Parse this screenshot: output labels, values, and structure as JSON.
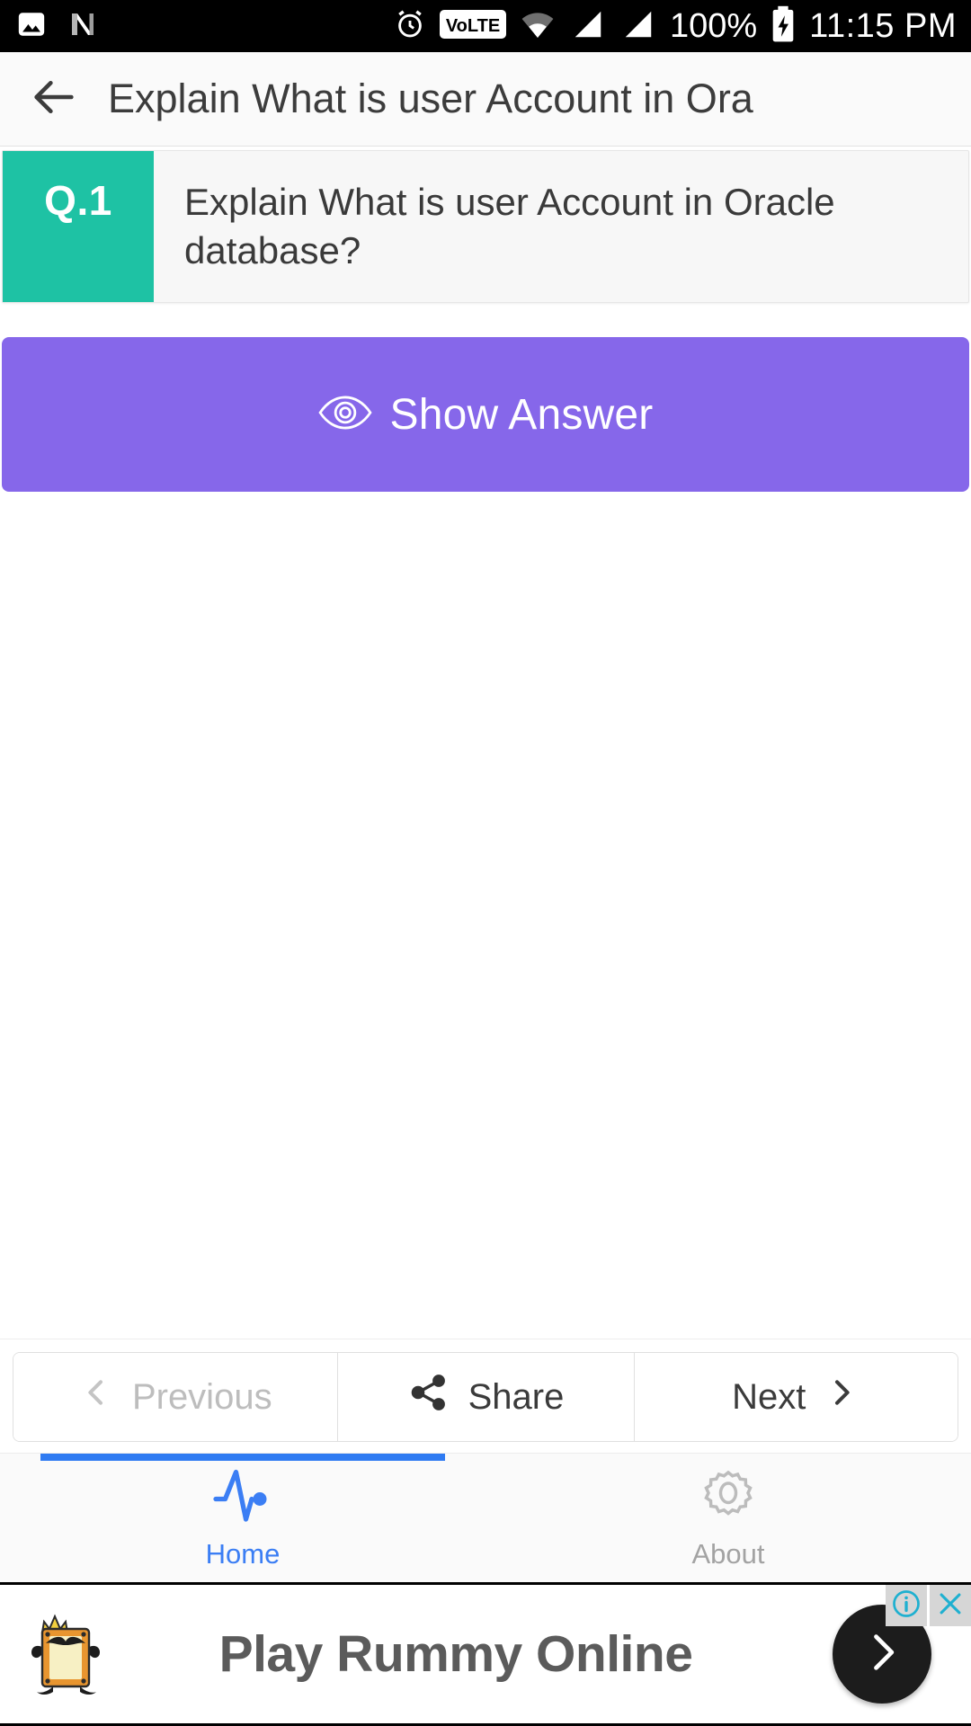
{
  "statusbar": {
    "icons_left": [
      "photo-icon",
      "android-nougat-icon"
    ],
    "icons_right": [
      "alarm-icon",
      "volte-icon",
      "wifi-icon",
      "signal-1-icon",
      "signal-2-icon",
      "battery-charging-icon"
    ],
    "volte_label": "VoLTE",
    "battery_percent": "100%",
    "time": "11:15 PM"
  },
  "toolbar": {
    "back_icon": "arrow-left-icon",
    "title": "Explain What is user Account in Ora"
  },
  "question": {
    "number_label": "Q.1",
    "text": "Explain What is user Account in Oracle database?",
    "badge_color": "#1ec2a4"
  },
  "show_answer": {
    "label": "Show Answer",
    "icon": "eye-icon",
    "color": "#8667ea"
  },
  "pager": {
    "previous_label": "Previous",
    "previous_enabled": false,
    "share_label": "Share",
    "next_label": "Next"
  },
  "tabs": [
    {
      "label": "Home",
      "icon": "activity-pulse-icon",
      "active": true,
      "color": "#3b7ef4"
    },
    {
      "label": "About",
      "icon": "gear-icon",
      "active": false,
      "color": "#a3a3a3"
    }
  ],
  "ad": {
    "headline": "Play Rummy Online",
    "mascot": "rummy-card-mascot-icon",
    "cta_icon": "chevron-right-icon",
    "info_icon": "adchoices-info-icon",
    "close_icon": "close-icon",
    "accent_color": "#1eb0d0"
  }
}
